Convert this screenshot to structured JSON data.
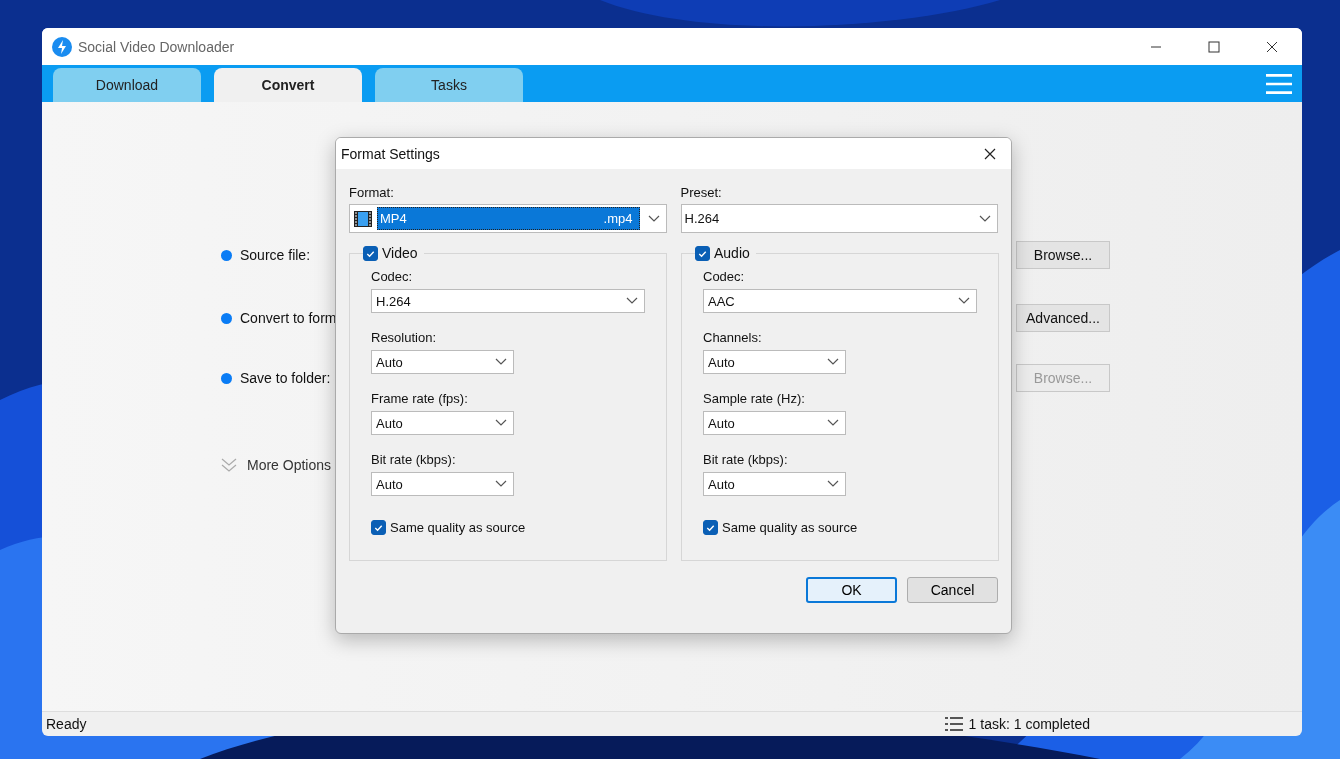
{
  "window": {
    "title": "Social Video Downloader"
  },
  "tabs": [
    {
      "label": "Download",
      "selected": false
    },
    {
      "label": "Convert",
      "selected": true
    },
    {
      "label": "Tasks",
      "selected": false
    }
  ],
  "main": {
    "rows": [
      {
        "label": "Source file:",
        "button": {
          "label": "Browse...",
          "disabled": false
        }
      },
      {
        "label": "Convert to form",
        "button": {
          "label": "Advanced...",
          "disabled": false
        }
      },
      {
        "label": "Save to folder:",
        "button": {
          "label": "Browse...",
          "disabled": true
        }
      }
    ],
    "more_options": "More Options"
  },
  "dialog": {
    "title": "Format Settings",
    "format": {
      "label": "Format:",
      "value": "MP4",
      "extension": ".mp4"
    },
    "preset": {
      "label": "Preset:",
      "value": "H.264"
    },
    "groups": [
      {
        "title": "Video",
        "checked": true,
        "fields": [
          {
            "label": "Codec:",
            "value": "H.264",
            "kind": "wide"
          },
          {
            "label": "Resolution:",
            "value": "Auto",
            "kind": "narrow"
          },
          {
            "label": "Frame rate (fps):",
            "value": "Auto",
            "kind": "narrow"
          },
          {
            "label": "Bit rate (kbps):",
            "value": "Auto",
            "kind": "narrow"
          }
        ],
        "same_quality": {
          "label": "Same quality as source",
          "checked": true
        }
      },
      {
        "title": "Audio",
        "checked": true,
        "fields": [
          {
            "label": "Codec:",
            "value": "AAC",
            "kind": "wide"
          },
          {
            "label": "Channels:",
            "value": "Auto",
            "kind": "narrow"
          },
          {
            "label": "Sample rate (Hz):",
            "value": "Auto",
            "kind": "narrow"
          },
          {
            "label": "Bit rate (kbps):",
            "value": "Auto",
            "kind": "narrow"
          }
        ],
        "same_quality": {
          "label": "Same quality as source",
          "checked": true
        }
      }
    ],
    "buttons": [
      {
        "label": "OK",
        "default": true
      },
      {
        "label": "Cancel",
        "default": false
      }
    ]
  },
  "status_bar": {
    "left": "Ready",
    "right": "1 task: 1 completed"
  }
}
